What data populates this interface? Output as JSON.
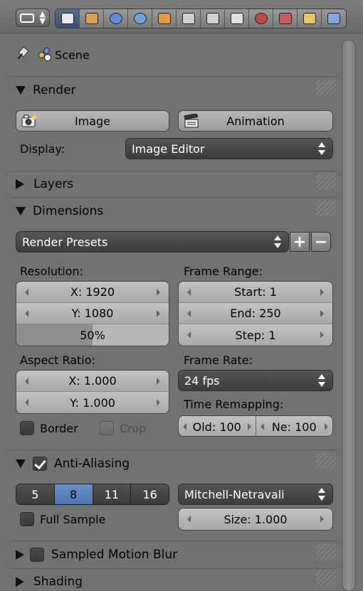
{
  "header": {
    "editor_type_icon": "properties-editor-icon",
    "tabs": [
      {
        "icon": "render-camera-icon",
        "active": true,
        "color": "#e8e8e8"
      },
      {
        "icon": "render-layers-icon",
        "active": false,
        "color": "#d9a24a"
      },
      {
        "icon": "scene-icon",
        "active": false,
        "color": "#5d8fd6"
      },
      {
        "icon": "world-icon",
        "active": false,
        "color": "#6fa3d4"
      },
      {
        "icon": "object-icon",
        "active": false,
        "color": "#e39a3b"
      },
      {
        "icon": "constraints-icon",
        "active": false,
        "color": "#cfcfcf"
      },
      {
        "icon": "modifiers-wrench-icon",
        "active": false,
        "color": "#d0d0d0"
      },
      {
        "icon": "data-mesh-icon",
        "active": false,
        "color": "#e0e0e0"
      },
      {
        "icon": "material-icon",
        "active": false,
        "color": "#c44a4a"
      },
      {
        "icon": "texture-icon",
        "active": false,
        "color": "#c85a5a"
      },
      {
        "icon": "particles-icon",
        "active": false,
        "color": "#e6c862"
      },
      {
        "icon": "physics-icon",
        "active": false,
        "color": "#7fa8dc"
      }
    ]
  },
  "context": {
    "scene_label": "Scene"
  },
  "render": {
    "title": "Render",
    "image_label": "Image",
    "animation_label": "Animation",
    "display_label": "Display:",
    "display_value": "Image Editor"
  },
  "layers": {
    "title": "Layers"
  },
  "dimensions": {
    "title": "Dimensions",
    "presets": "Render Presets",
    "resolution_label": "Resolution:",
    "res_x": "X: 1920",
    "res_y": "Y: 1080",
    "res_pct": "50%",
    "res_pct_value": 0.5,
    "frame_range_label": "Frame Range:",
    "start": "Start: 1",
    "end": "End: 250",
    "step": "Step: 1",
    "aspect_label": "Aspect Ratio:",
    "aspect_x": "X: 1.000",
    "aspect_y": "Y: 1.000",
    "frame_rate_label": "Frame Rate:",
    "frame_rate": "24 fps",
    "border_label": "Border",
    "crop_label": "Crop",
    "time_remap_label": "Time Remapping:",
    "old": "Old: 100",
    "new": "Ne: 100"
  },
  "antialiasing": {
    "title": "Anti-Aliasing",
    "enabled": true,
    "samples": [
      "5",
      "8",
      "11",
      "16"
    ],
    "active_sample": "8",
    "filter": "Mitchell-Netravali",
    "full_sample_label": "Full Sample",
    "size": "Size: 1.000"
  },
  "motion_blur": {
    "title": "Sampled Motion Blur"
  },
  "shading": {
    "title": "Shading"
  },
  "colors": {
    "accent_blue": "#5a7fb8",
    "panel_bg": "#727272",
    "dark_widget": "#444444"
  }
}
